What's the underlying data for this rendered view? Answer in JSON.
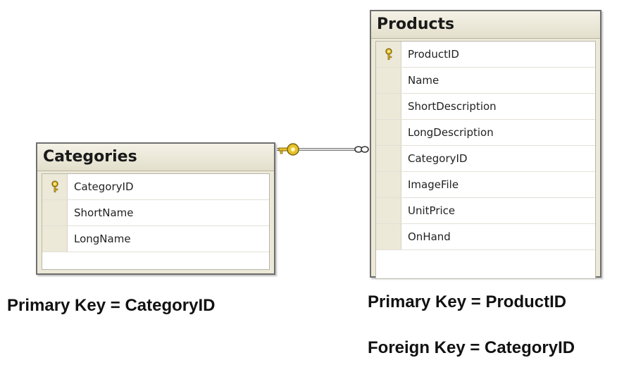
{
  "tables": {
    "categories": {
      "title": "Categories",
      "columns": [
        {
          "name": "CategoryID",
          "key": true
        },
        {
          "name": "ShortName",
          "key": false
        },
        {
          "name": "LongName",
          "key": false
        }
      ]
    },
    "products": {
      "title": "Products",
      "columns": [
        {
          "name": "ProductID",
          "key": true
        },
        {
          "name": "Name",
          "key": false
        },
        {
          "name": "ShortDescription",
          "key": false
        },
        {
          "name": "LongDescription",
          "key": false
        },
        {
          "name": "CategoryID",
          "key": false
        },
        {
          "name": "ImageFile",
          "key": false
        },
        {
          "name": "UnitPrice",
          "key": false
        },
        {
          "name": "OnHand",
          "key": false
        }
      ]
    }
  },
  "relationship": {
    "one_side": "Categories",
    "many_side": "Products",
    "one_end_icon": "key-icon",
    "many_end_icon": "infinity-icon"
  },
  "captions": {
    "categories_pk": "Primary Key = CategoryID",
    "products_pk": "Primary Key = ProductID",
    "products_fk": "Foreign Key = CategoryID"
  },
  "colors": {
    "key_gold": "#d4b020",
    "table_bg": "#ece9d8",
    "border": "#6f6f6f"
  }
}
